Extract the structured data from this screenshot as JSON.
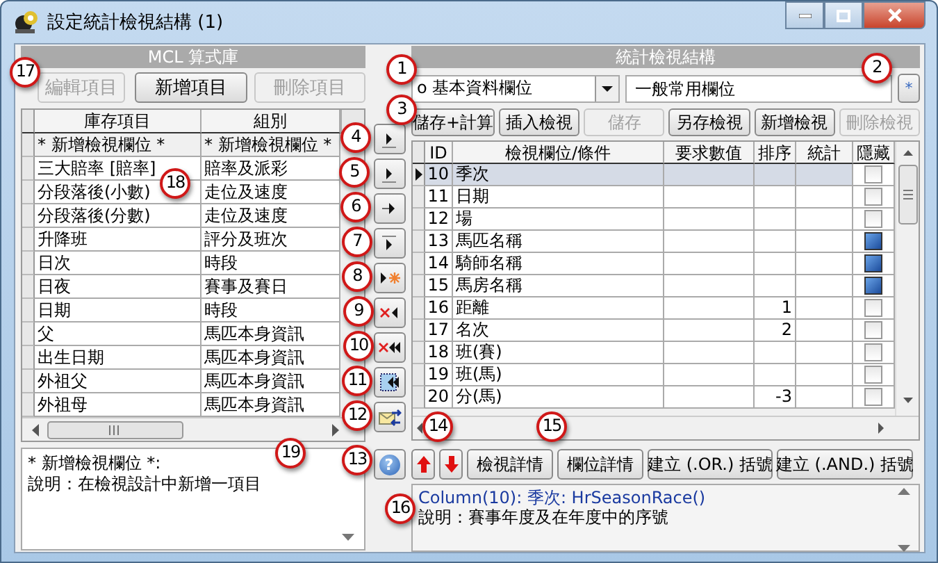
{
  "window": {
    "title": "設定統計檢視結構 (1)"
  },
  "library": {
    "title": "MCL 算式庫",
    "buttons": [
      {
        "label": "編輯項目",
        "disabled": true
      },
      {
        "label": "新增項目",
        "disabled": false
      },
      {
        "label": "刪除項目",
        "disabled": true
      }
    ],
    "columns": [
      "庫存項目",
      "組別"
    ],
    "rows": [
      {
        "item": "* 新增檢視欄位 *",
        "group": "* 新增檢視欄位 *"
      },
      {
        "item": "三大賠率 [賠率]",
        "group": "賠率及派彩"
      },
      {
        "item": "分段落後(小數)",
        "group": "走位及速度"
      },
      {
        "item": "分段落後(分數)",
        "group": "走位及速度"
      },
      {
        "item": "升降班",
        "group": "評分及班次"
      },
      {
        "item": "日次",
        "group": "時段"
      },
      {
        "item": "日夜",
        "group": "賽事及賽日"
      },
      {
        "item": "日期",
        "group": "時段"
      },
      {
        "item": "父",
        "group": "馬匹本身資訊"
      },
      {
        "item": "出生日期",
        "group": "馬匹本身資訊"
      },
      {
        "item": "外祖父",
        "group": "馬匹本身資訊"
      },
      {
        "item": "外祖母",
        "group": "馬匹本身資訊"
      }
    ],
    "description": [
      "* 新增檢視欄位 *:",
      "說明：在檢視設計中新增一項目"
    ],
    "help_glyph": "?"
  },
  "structure": {
    "title": "統計檢視結構",
    "category": "o 基本資料欄位",
    "field_set": "一般常用欄位",
    "star_button": "*",
    "buttons": [
      {
        "label": "儲存+計算",
        "disabled": false
      },
      {
        "label": "插入檢視",
        "disabled": false
      },
      {
        "label": "儲存",
        "disabled": true
      },
      {
        "label": "另存檢視",
        "disabled": false
      },
      {
        "label": "新增檢視",
        "disabled": false
      },
      {
        "label": "刪除檢視",
        "disabled": true
      }
    ],
    "columns": [
      "ID",
      "檢視欄位/條件",
      "要求數值",
      "排序",
      "統計",
      "隱藏"
    ],
    "rows": [
      {
        "id": "10",
        "name": "季次",
        "selected": true,
        "hidden": false
      },
      {
        "id": "11",
        "name": "日期",
        "selected": false,
        "hidden": false
      },
      {
        "id": "12",
        "name": "場",
        "selected": false,
        "hidden": false
      },
      {
        "id": "13",
        "name": "馬匹名稱",
        "selected": false,
        "hidden": true
      },
      {
        "id": "14",
        "name": "騎師名稱",
        "selected": false,
        "hidden": true
      },
      {
        "id": "15",
        "name": "馬房名稱",
        "selected": false,
        "hidden": true
      },
      {
        "id": "16",
        "name": "距離",
        "sort": "1",
        "selected": false,
        "hidden": false
      },
      {
        "id": "17",
        "name": "名次",
        "sort": "2",
        "selected": false,
        "hidden": false
      },
      {
        "id": "18",
        "name": "班(賽)",
        "selected": false,
        "hidden": false
      },
      {
        "id": "19",
        "name": "班(馬)",
        "selected": false,
        "hidden": false
      },
      {
        "id": "20",
        "name": "分(馬)",
        "sort": "-3",
        "selected": false,
        "hidden": false
      }
    ],
    "detail_buttons": [
      "檢視詳情",
      "欄位詳情",
      "建立 (.OR.) 括號",
      "建立 (.AND.) 括號"
    ],
    "info": {
      "signature": "Column(10): 季次: HrSeasonRace()",
      "description": "說明：賽事年度及在年度中的序號"
    }
  },
  "callouts": [
    "1",
    "2",
    "3",
    "4",
    "5",
    "6",
    "7",
    "8",
    "9",
    "10",
    "11",
    "12",
    "13",
    "14",
    "15",
    "16",
    "17",
    "18",
    "19"
  ]
}
